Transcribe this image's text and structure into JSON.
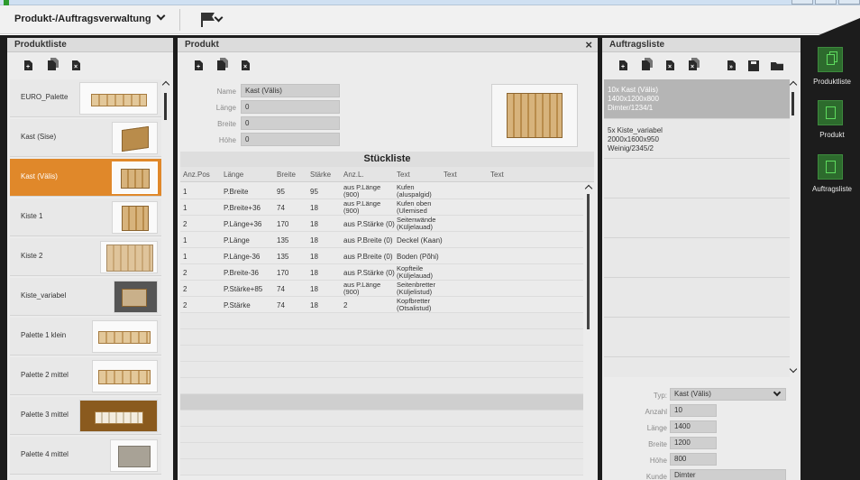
{
  "app": {
    "menu_title": "Produkt-/Auftragsverwaltung"
  },
  "panels": {
    "left_title": "Produktliste",
    "center_title": "Produkt",
    "right_title": "Auftragsliste"
  },
  "product_list": [
    {
      "label": "EURO_Palette"
    },
    {
      "label": "Kast (Sise)"
    },
    {
      "label": "Kast (Välis)",
      "selected": true
    },
    {
      "label": "Kiste 1"
    },
    {
      "label": "Kiste 2"
    },
    {
      "label": "Kiste_variabel"
    },
    {
      "label": "Palette 1 klein"
    },
    {
      "label": "Palette 2 mittel"
    },
    {
      "label": "Palette 3 mittel"
    },
    {
      "label": "Palette 4 mittel"
    }
  ],
  "product": {
    "close_glyph": "×",
    "fields": {
      "name_label": "Name",
      "name_value": "Kast (Välis)",
      "laenge_label": "Länge",
      "laenge_value": "0",
      "breite_label": "Breite",
      "breite_value": "0",
      "hoehe_label": "Höhe",
      "hoehe_value": "0"
    }
  },
  "stueckliste": {
    "title": "Stückliste",
    "columns": [
      "Anz.Pos",
      "Länge",
      "Breite",
      "Stärke",
      "Anz.L.",
      "Text",
      "Text",
      "Text"
    ],
    "rows": [
      [
        "1",
        "P.Breite",
        "95",
        "95",
        "aus P.Länge (900)",
        "Kufen (aluspalgid)"
      ],
      [
        "1",
        "P.Breite+36",
        "74",
        "18",
        "aus P.Länge (900)",
        "Kufen oben (Ulemised"
      ],
      [
        "2",
        "P.Länge+36",
        "170",
        "18",
        "aus P.Stärke (0)",
        "Seitenwände (Küljelauad)"
      ],
      [
        "1",
        "P.Länge",
        "135",
        "18",
        "aus P.Breite (0)",
        "Deckel (Kaan)"
      ],
      [
        "1",
        "P.Länge-36",
        "135",
        "18",
        "aus P.Breite (0)",
        "Boden (Põhi)"
      ],
      [
        "2",
        "P.Breite-36",
        "170",
        "18",
        "aus P.Stärke (0)",
        "Kopfteile (Küljelauad)"
      ],
      [
        "2",
        "P.Stärke+85",
        "74",
        "18",
        "aus P.Länge (900)",
        "Seitenbretter (Küljelistud)"
      ],
      [
        "2",
        "P.Stärke",
        "74",
        "18",
        "2",
        "Kopfbretter (Otsalistud)"
      ]
    ]
  },
  "orders": [
    {
      "lines": [
        "10x Kast (Välis)",
        "1400x1200x800",
        "Dimter/1234/1"
      ],
      "selected": true
    },
    {
      "lines": [
        "5x Kiste_variabel",
        "2000x1600x950",
        "Weinig/2345/2"
      ]
    }
  ],
  "order_detail": {
    "typ_label": "Typ:",
    "typ_value": "Kast (Välis)",
    "anzahl_label": "Anzahl",
    "anzahl_value": "10",
    "laenge_label": "Länge",
    "laenge_value": "1400",
    "breite_label": "Breite",
    "breite_value": "1200",
    "hoehe_label": "Höhe",
    "hoehe_value": "800",
    "kunde_label": "Kunde",
    "kunde_value": "Dimter"
  },
  "nav": [
    {
      "label": "Produktliste"
    },
    {
      "label": "Produkt"
    },
    {
      "label": "Auftragsliste"
    }
  ],
  "colors": {
    "accent": "#e0882a",
    "frame": "#1c1c1c",
    "nav_green": "#2d6b2d"
  }
}
